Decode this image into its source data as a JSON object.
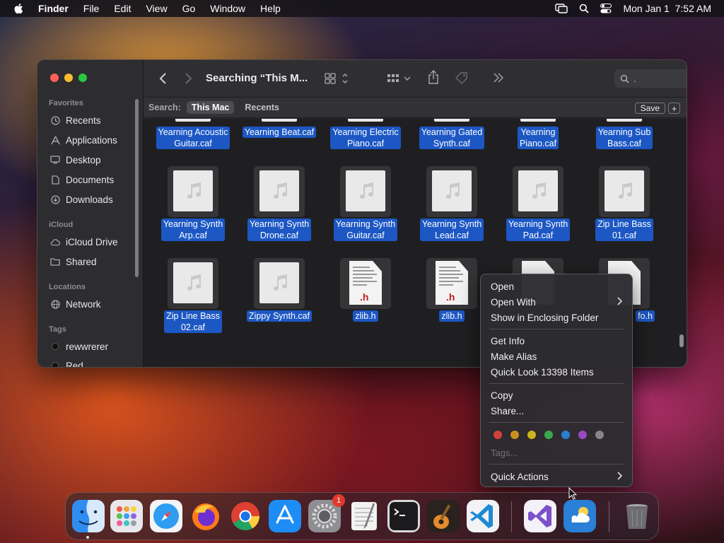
{
  "menubar": {
    "app": "Finder",
    "items": [
      "File",
      "Edit",
      "View",
      "Go",
      "Window",
      "Help"
    ],
    "clock": "Mon Jan 1  7:52 AM"
  },
  "toolbar": {
    "title": "Searching “This M...",
    "search_value": "."
  },
  "scopebar": {
    "label": "Search:",
    "scopes": [
      "This Mac",
      "Recents"
    ],
    "active_scope": "This Mac",
    "save_label": "Save",
    "add_label": "+"
  },
  "sidebar": {
    "sections": [
      {
        "title": "Favorites",
        "items": [
          {
            "label": "Recents",
            "icon": "clock-icon"
          },
          {
            "label": "Applications",
            "icon": "applications-icon"
          },
          {
            "label": "Desktop",
            "icon": "desktop-icon"
          },
          {
            "label": "Documents",
            "icon": "document-icon"
          },
          {
            "label": "Downloads",
            "icon": "download-icon"
          }
        ]
      },
      {
        "title": "iCloud",
        "items": [
          {
            "label": "iCloud Drive",
            "icon": "cloud-icon"
          },
          {
            "label": "Shared",
            "icon": "shared-folder-icon"
          }
        ]
      },
      {
        "title": "Locations",
        "items": [
          {
            "label": "Network",
            "icon": "globe-icon"
          }
        ]
      },
      {
        "title": "Tags",
        "items": [
          {
            "label": "rewwrerer",
            "icon": "tag-dot-icon"
          },
          {
            "label": "Red",
            "icon": "tag-dot-icon"
          }
        ]
      }
    ]
  },
  "files": [
    {
      "name": "Yearning Acoustic Guitar.caf",
      "kind": "audio"
    },
    {
      "name": "Yearning Beat.caf",
      "kind": "audio"
    },
    {
      "name": "Yearning Electric Piano.caf",
      "kind": "audio"
    },
    {
      "name": "Yearning Gated Synth.caf",
      "kind": "audio"
    },
    {
      "name": "Yearning Piano.caf",
      "kind": "audio"
    },
    {
      "name": "Yearning Sub Bass.caf",
      "kind": "audio"
    },
    {
      "name": "Yearning Synth Arp.caf",
      "kind": "audio"
    },
    {
      "name": "Yearning Synth Drone.caf",
      "kind": "audio"
    },
    {
      "name": "Yearning Synth Guitar.caf",
      "kind": "audio"
    },
    {
      "name": "Yearning Synth Lead.caf",
      "kind": "audio"
    },
    {
      "name": "Yearning Synth Pad.caf",
      "kind": "audio"
    },
    {
      "name": "Zip Line Bass 01.caf",
      "kind": "audio"
    },
    {
      "name": "Zip Line Bass 02.caf",
      "kind": "audio"
    },
    {
      "name": "Zippy Synth.caf",
      "kind": "audio"
    },
    {
      "name": "zlib.h",
      "kind": "header"
    },
    {
      "name": "zlib.h",
      "kind": "header"
    },
    {
      "name": "",
      "kind": "header"
    },
    {
      "name": "fo.h",
      "kind": "header"
    }
  ],
  "file_labels": {
    "f0a": "Yearning Acoustic",
    "f0b": "Guitar.caf",
    "f1a": "Yearning Beat.caf",
    "f2a": "Yearning Electric",
    "f2b": "Piano.caf",
    "f3a": "Yearning Gated",
    "f3b": "Synth.caf",
    "f4a": "Yearning",
    "f4b": "Piano.caf",
    "f5a": "Yearning Sub",
    "f5b": "Bass.caf",
    "f6a": "Yearning Synth",
    "f6b": "Arp.caf",
    "f7a": "Yearning Synth",
    "f7b": "Drone.caf",
    "f8a": "Yearning Synth",
    "f8b": "Guitar.caf",
    "f9a": "Yearning Synth",
    "f9b": "Lead.caf",
    "f10a": "Yearning Synth",
    "f10b": "Pad.caf",
    "f11a": "Zip Line Bass",
    "f11b": "01.caf",
    "f12a": "Zip Line Bass",
    "f12b": "02.caf",
    "f13a": "Zippy Synth.caf",
    "f14a": "zlib.h",
    "f15a": "zlib.h",
    "f17a": "fo.h",
    "header_ext": ".h"
  },
  "context_menu": {
    "items": {
      "open": "Open",
      "open_with": "Open With",
      "show_enclosing": "Show in Enclosing Folder",
      "get_info": "Get Info",
      "make_alias": "Make Alias",
      "quick_look": "Quick Look 13398 Items",
      "copy": "Copy",
      "share": "Share...",
      "tags": "Tags...",
      "quick_actions": "Quick Actions"
    },
    "tag_colors": [
      "#e0433a",
      "#d9921e",
      "#d7c21f",
      "#3fb34f",
      "#2d86d9",
      "#a04bcf",
      "#8b8b8f"
    ]
  },
  "dock": {
    "apps": [
      "finder-icon",
      "launchpad-icon",
      "safari-icon",
      "firefox-icon",
      "chrome-icon",
      "app-store-icon",
      "system-settings-icon",
      "textedit-icon",
      "terminal-icon",
      "garageband-icon",
      "vscode-icon",
      "visual-studio-icon",
      "weather-icon",
      "trash-icon"
    ],
    "settings_badge": "1"
  },
  "colors": {
    "selection": "#1c57c4",
    "accent": "#0a84ff"
  }
}
